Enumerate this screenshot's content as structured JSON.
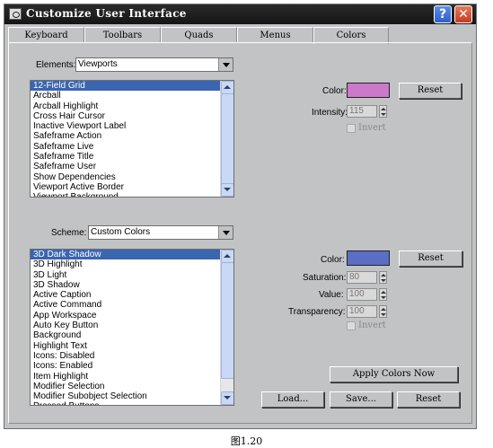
{
  "window": {
    "title": "Customize User Interface",
    "help_glyph": "?",
    "close_glyph": "✕"
  },
  "tabs": [
    {
      "label": "Keyboard"
    },
    {
      "label": "Toolbars"
    },
    {
      "label": "Quads"
    },
    {
      "label": "Menus"
    },
    {
      "label": "Colors",
      "active": true
    }
  ],
  "elements": {
    "label": "Elements:",
    "selected": "Viewports",
    "items": [
      "12-Field Grid",
      "Arcball",
      "Arcball Highlight",
      "Cross Hair Cursor",
      "Inactive Viewport Label",
      "Safeframe Action",
      "Safeframe Live",
      "Safeframe Title",
      "Safeframe User",
      "Show Dependencies",
      "Viewport Active Border",
      "Viewport Background"
    ],
    "selected_index": 0
  },
  "element_color": {
    "color_label": "Color:",
    "color_value": "#cc79c9",
    "reset_label": "Reset",
    "intensity_label": "Intensity:",
    "intensity_value": "115",
    "invert_label": "Invert"
  },
  "scheme": {
    "label": "Scheme:",
    "selected": "Custom Colors",
    "items": [
      "3D Dark Shadow",
      "3D Highlight",
      "3D Light",
      "3D Shadow",
      "Active Caption",
      "Active Command",
      "App Workspace",
      "Auto Key Button",
      "Background",
      "Highlight Text",
      "Icons: Disabled",
      "Icons: Enabled",
      "Item Highlight",
      "Modifier Selection",
      "Modifier Subobject Selection",
      "Pressed Buttons"
    ],
    "selected_index": 0
  },
  "scheme_color": {
    "color_label": "Color:",
    "color_value": "#5b6ec6",
    "reset_label": "Reset",
    "saturation_label": "Saturation:",
    "saturation_value": "80",
    "value_label": "Value:",
    "value_value": "100",
    "transparency_label": "Transparency:",
    "transparency_value": "100",
    "invert_label": "Invert"
  },
  "buttons": {
    "apply": "Apply Colors Now",
    "load": "Load...",
    "save": "Save...",
    "reset": "Reset"
  },
  "caption": "图1.20"
}
